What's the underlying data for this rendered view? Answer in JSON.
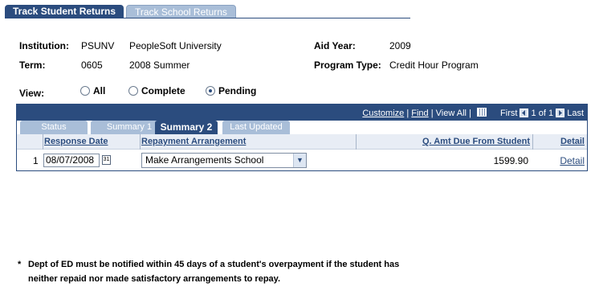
{
  "top_tabs": {
    "active": "Track Student Returns",
    "inactive": "Track School Returns"
  },
  "fields": {
    "institution_label": "Institution:",
    "institution_code": "PSUNV",
    "institution_name": "PeopleSoft University",
    "term_label": "Term:",
    "term_code": "0605",
    "term_name": "2008 Summer",
    "aid_year_label": "Aid Year:",
    "aid_year_value": "2009",
    "program_type_label": "Program Type:",
    "program_type_value": "Credit Hour Program"
  },
  "view": {
    "label": "View:",
    "options": [
      "All",
      "Complete",
      "Pending"
    ],
    "selected": "Pending"
  },
  "grid": {
    "nav": {
      "customize": "Customize",
      "find": "Find",
      "view_all": "View All",
      "first": "First",
      "range": "1 of 1",
      "last": "Last"
    },
    "tabs": [
      "Status",
      "Summary 1",
      "Summary 2",
      "Last Updated"
    ],
    "active_tab": "Summary 2",
    "columns": {
      "response_date": "Response Date",
      "repayment": "Repayment Arrangement",
      "amount": "Q. Amt Due From Student",
      "detail": "Detail"
    },
    "rows": [
      {
        "num": "1",
        "response_date": "08/07/2008",
        "calendar_day": "31",
        "repayment": "Make Arrangements School",
        "amount": "1599.90",
        "detail": "Detail"
      }
    ]
  },
  "note": {
    "marker": "*",
    "line1": "Dept of ED must be notified  within 45 days of a student's overpayment if the student has",
    "line2": "neither repaid nor made satisfactory arrangements to  repay."
  },
  "colors": {
    "primary": "#2b4c7e",
    "inactive_tab": "#a9bed8",
    "link": "#2b4c7e"
  }
}
